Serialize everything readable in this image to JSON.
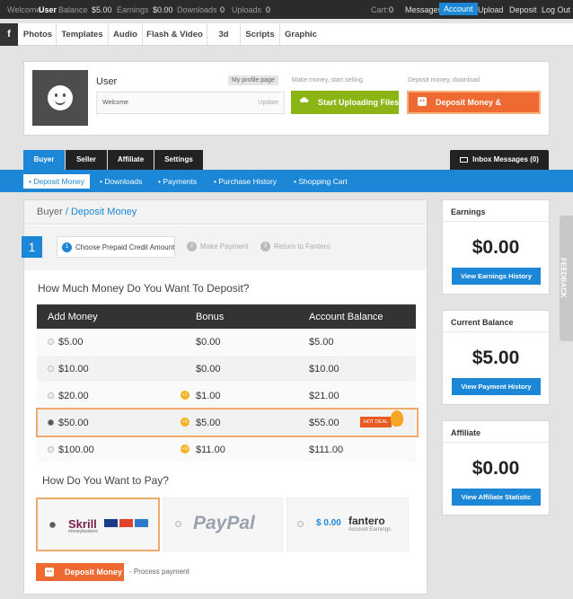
{
  "topbar": {
    "welcome_label": "Welcome",
    "username": "User",
    "balance_label": "Balance",
    "balance_value": "$5.00",
    "earnings_label": "Earnings",
    "earnings_value": "$0.00",
    "downloads_label": "Downloads",
    "downloads_value": "0",
    "uploads_label": "Uploads",
    "uploads_value": "0",
    "cart_label": "Cart:",
    "cart_value": "0",
    "links": [
      "Messages",
      "Account",
      "Upload",
      "Deposit",
      "Log Out"
    ],
    "active_link": "Account"
  },
  "catbar": {
    "logo": "f",
    "items": [
      "Photos",
      "Templates",
      "Audio",
      "Flash & Video",
      "3d",
      "Scripts",
      "Graphic"
    ]
  },
  "profile": {
    "name": "User",
    "my_profile": "My profile page",
    "welcome": "Welcome",
    "update": "Update",
    "upload_hint": "Make money, start selling",
    "upload_button": "Start Uploading Files",
    "deposit_hint": "Deposit money, download",
    "deposit_button": "Deposit Money & Download"
  },
  "tabs": [
    "Buyer",
    "Seller",
    "Affiliate",
    "Settings"
  ],
  "inbox_button": "Inbox Messages (0)",
  "subnav": [
    "Deposit Money",
    "Downloads",
    "Payments",
    "Purchase History",
    "Shopping Cart"
  ],
  "breadcrumb": {
    "root": "Buyer",
    "sep": "/",
    "current": "Deposit Money"
  },
  "stepper": {
    "number": "1",
    "steps": [
      {
        "num": "1",
        "label": "Choose Prepaid Credit Amount"
      },
      {
        "num": "2",
        "label": "Make Payment"
      },
      {
        "num": "3",
        "label": "Return to Fantero"
      }
    ]
  },
  "deposit": {
    "question": "How Much Money Do You Want To Deposit?",
    "headers": [
      "Add Money",
      "Bonus",
      "Account Balance"
    ],
    "rows": [
      {
        "amount": "$5.00",
        "bonus": "$0.00",
        "balance": "$5.00",
        "coin": ""
      },
      {
        "amount": "$10.00",
        "bonus": "$0.00",
        "balance": "$10.00",
        "coin": ""
      },
      {
        "amount": "$20.00",
        "bonus": "$1.00",
        "balance": "$21.00",
        "coin": "+1"
      },
      {
        "amount": "$50.00",
        "bonus": "$5.00",
        "balance": "$55.00",
        "coin": "+5"
      },
      {
        "amount": "$100.00",
        "bonus": "$11.00",
        "balance": "$111.00",
        "coin": "+11"
      }
    ],
    "selected_index": 3,
    "hot_deal": "HOT DEAL"
  },
  "payment": {
    "question": "How Do You Want to Pay?",
    "skrill": "Skrill",
    "skrill_sub": "moneybookers",
    "paypal": "PayPal",
    "fantero_amount": "$ 0.00",
    "fantero_name": "fantero",
    "fantero_sub": "Account Earnings",
    "button": "Deposit Money",
    "process_note": "- Process payment"
  },
  "sidebar": {
    "earnings": {
      "title": "Earnings",
      "amount": "$0.00",
      "button": "View Earnings History"
    },
    "balance": {
      "title": "Current Balance",
      "amount": "$5.00",
      "button": "View Payment History"
    },
    "affiliate": {
      "title": "Affiliate",
      "amount": "$0.00",
      "button": "View Affiliate Statistic"
    }
  },
  "feedback": "FEEDBACK",
  "colors": {
    "accent": "#1b87d6",
    "orange": "#ef6a32",
    "green": "#8ab514",
    "dark": "#2b2b2b"
  }
}
